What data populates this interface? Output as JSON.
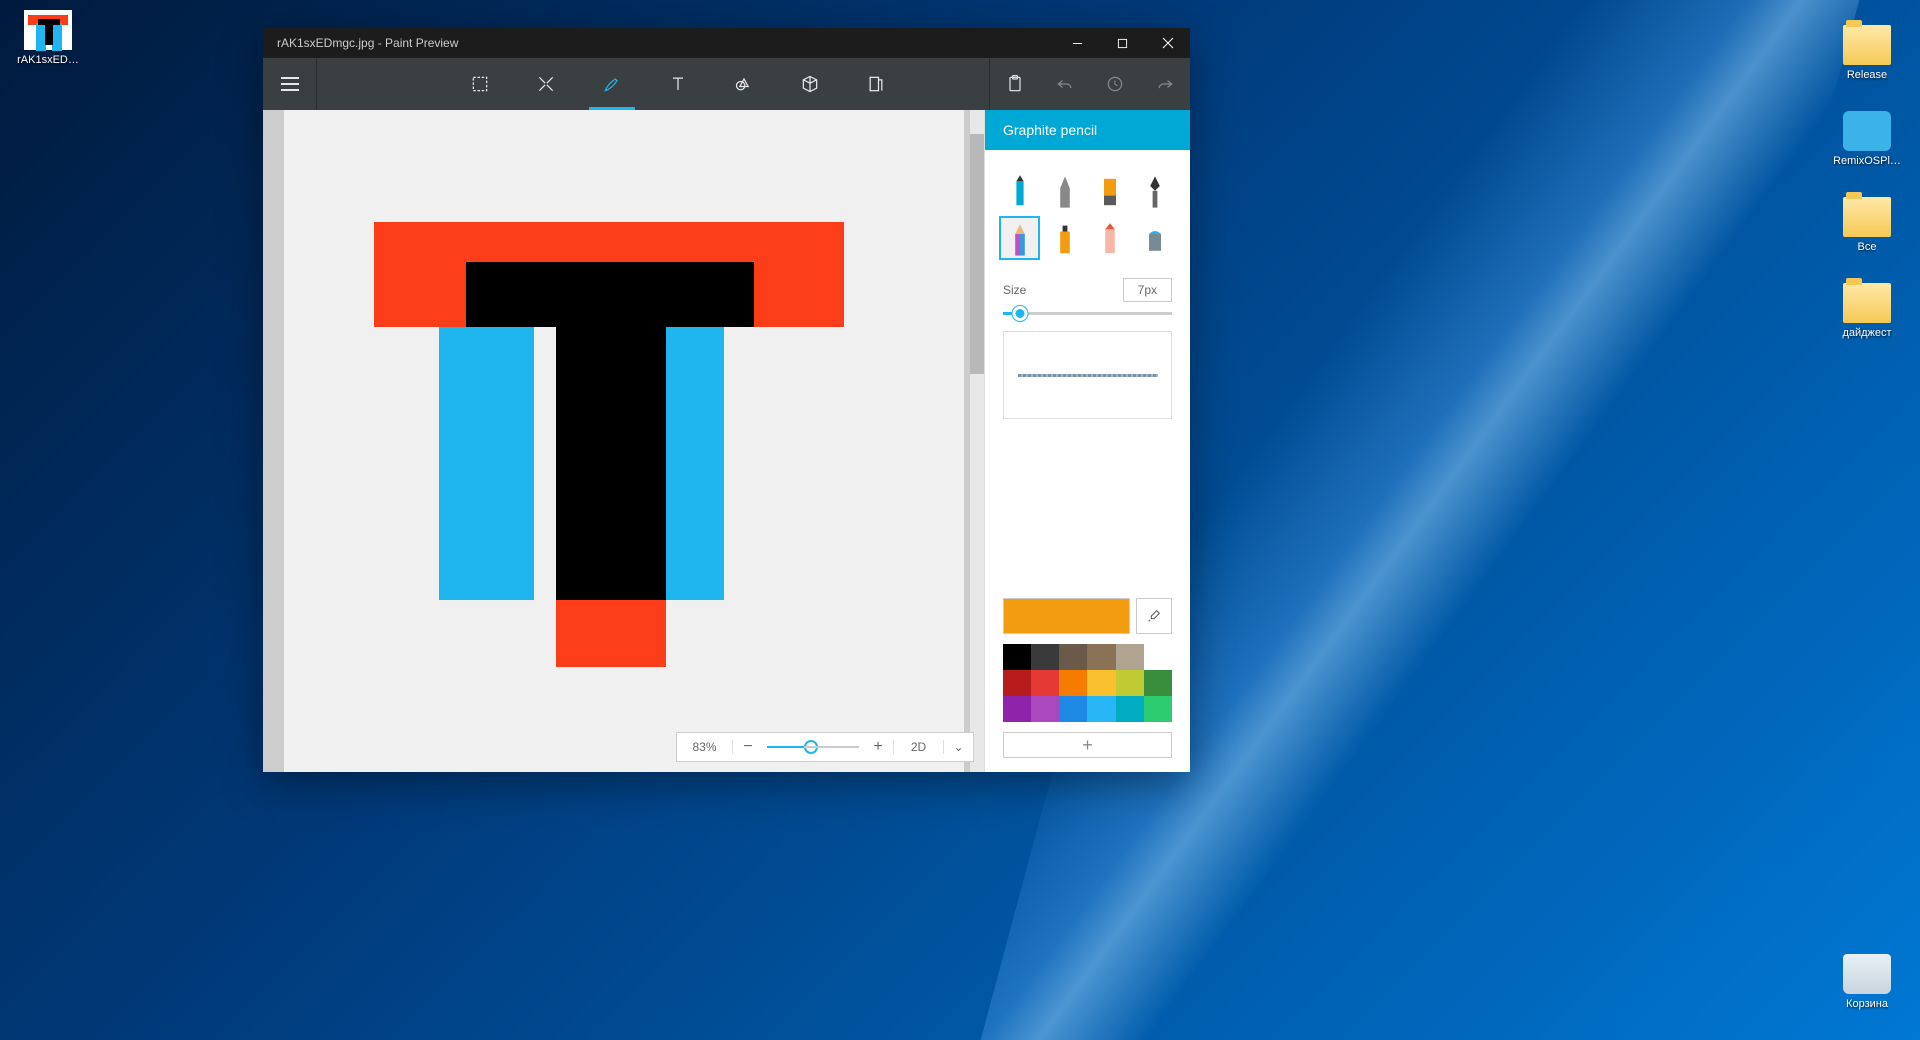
{
  "desktop": {
    "topLeftFile": "rAK1sxED…",
    "rightIcons": [
      {
        "label": "Release",
        "type": "folder"
      },
      {
        "label": "RemixOSPl…",
        "type": "app"
      },
      {
        "label": "Все",
        "type": "folder"
      },
      {
        "label": "дайджест",
        "type": "folder"
      }
    ],
    "recycleBin": "Корзина"
  },
  "app": {
    "title": "rAK1sxEDmgc.jpg - Paint Preview",
    "toolbar": {
      "tools": [
        "select",
        "crop",
        "brush",
        "text",
        "shapes",
        "3d",
        "stickers"
      ],
      "activeIndex": 2
    },
    "zoom": {
      "value": "83%",
      "mode": "2D"
    },
    "panel": {
      "header": "Graphite pencil",
      "sizeLabel": "Size",
      "sizeValue": "7px",
      "currentColor": "#f39c12",
      "palette": [
        "#000000",
        "#3a3a3a",
        "#6b5a4a",
        "#8a7257",
        "#b0a490",
        "#ffffff",
        "#b71c1c",
        "#e53935",
        "#f57c00",
        "#fbc02d",
        "#c0ca33",
        "#388e3c",
        "#8e24aa",
        "#ab47bc",
        "#1e88e5",
        "#29b6f6",
        "#00acc1",
        "#2ecc71"
      ],
      "addLabel": "+"
    }
  }
}
